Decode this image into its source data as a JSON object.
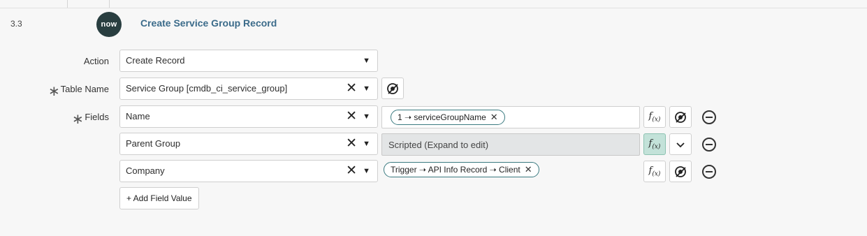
{
  "step": {
    "number": "3.3",
    "logo_text": "now",
    "title": "Create Service Group Record"
  },
  "action": {
    "label": "Action",
    "value": "Create Record"
  },
  "table_name": {
    "label": "Table Name",
    "value": "Service Group [cmdb_ci_service_group]"
  },
  "fields": {
    "label": "Fields",
    "rows": [
      {
        "field": "Name",
        "value_type": "pill",
        "value": "1 ➝ serviceGroupName",
        "remove_symbol": "✕",
        "fx_active": false,
        "right_icon": "data-pill-picker-icon"
      },
      {
        "field": "Parent Group",
        "value_type": "disabled",
        "value": "Scripted (Expand to edit)",
        "fx_active": true,
        "right_icon": "chevron-down-icon"
      },
      {
        "field": "Company",
        "value_type": "pill",
        "value": "Trigger ➝ API Info Record ➝ Client",
        "remove_symbol": "✕",
        "fx_active": false,
        "right_icon": "data-pill-picker-icon"
      }
    ]
  },
  "add_field_value_label": "+ Add Field Value",
  "symbols": {
    "required": "∗",
    "clear": "✕",
    "dropdown": "▼",
    "fx": "f",
    "fx_sub": "(x)"
  },
  "colors": {
    "logo_bg": "#293e40",
    "title": "#3b6b8a",
    "pill_border": "#3a7a80",
    "fx_active_bg": "#c3e2d9"
  }
}
